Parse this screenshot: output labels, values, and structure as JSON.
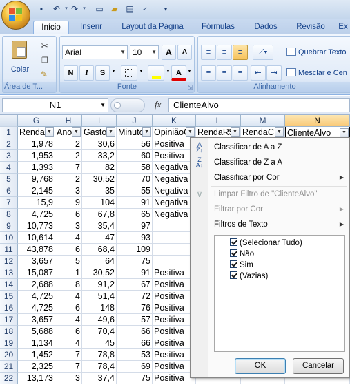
{
  "ribbon_tabs": [
    "Início",
    "Inserir",
    "Layout da Página",
    "Fórmulas",
    "Dados",
    "Revisão",
    "Ex"
  ],
  "clipboard": {
    "paste_label": "Colar",
    "group_label": "Área de T..."
  },
  "font": {
    "name": "Arial",
    "size": "10",
    "bold": "N",
    "italic": "I",
    "underline": "S",
    "group_label": "Fonte",
    "grow": "A",
    "shrink": "A"
  },
  "alignment": {
    "wrap_label": "Quebrar Texto",
    "merge_label": "Mesclar e Cen",
    "group_label": "Alinhamento"
  },
  "formula_bar": {
    "name_box": "N1",
    "fx": "fx",
    "content": "ClienteAlvo"
  },
  "columns": [
    "G",
    "H",
    "I",
    "J",
    "K",
    "L",
    "M",
    "N"
  ],
  "selected_column": "N",
  "row_numbers": [
    "1",
    "2",
    "3",
    "4",
    "5",
    "6",
    "7",
    "8",
    "9",
    "10",
    "11",
    "12",
    "13",
    "14",
    "15",
    "16",
    "17",
    "18",
    "19",
    "20",
    "21",
    "22"
  ],
  "headers": [
    "Renda",
    "Anos",
    "Gasto",
    "Minutos",
    "OpiniãoC",
    "RendaR$",
    "RendaC",
    "ClienteAlvo"
  ],
  "rows": [
    [
      "1,978",
      "2",
      "30,6",
      "56",
      "Positiva"
    ],
    [
      "1,953",
      "2",
      "33,2",
      "60",
      "Positiva"
    ],
    [
      "1,393",
      "7",
      "82",
      "58",
      "Negativa"
    ],
    [
      "9,768",
      "2",
      "30,52",
      "70",
      "Negativa"
    ],
    [
      "2,145",
      "3",
      "35",
      "55",
      "Negativa"
    ],
    [
      "15,9",
      "9",
      "104",
      "91",
      "Negativa"
    ],
    [
      "4,725",
      "6",
      "67,8",
      "65",
      "Negativa"
    ],
    [
      "10,773",
      "3",
      "35,4",
      "97",
      ""
    ],
    [
      "10,614",
      "4",
      "47",
      "93",
      ""
    ],
    [
      "43,878",
      "6",
      "68,4",
      "109",
      ""
    ],
    [
      "3,657",
      "5",
      "64",
      "75",
      ""
    ],
    [
      "15,087",
      "1",
      "30,52",
      "91",
      "Positiva"
    ],
    [
      "2,688",
      "8",
      "91,2",
      "67",
      "Positiva"
    ],
    [
      "4,725",
      "4",
      "51,4",
      "72",
      "Positiva"
    ],
    [
      "4,725",
      "6",
      "148",
      "76",
      "Positiva"
    ],
    [
      "3,657",
      "4",
      "49,6",
      "57",
      "Positiva"
    ],
    [
      "5,688",
      "6",
      "70,4",
      "66",
      "Positiva"
    ],
    [
      "1,134",
      "4",
      "45",
      "66",
      "Positiva"
    ],
    [
      "1,452",
      "7",
      "78,8",
      "53",
      "Positiva"
    ],
    [
      "2,325",
      "7",
      "78,4",
      "69",
      "Positiva"
    ],
    [
      "13,173",
      "3",
      "37,4",
      "75",
      "Positiva"
    ]
  ],
  "filter_menu": {
    "sort_az": "Classificar de A a Z",
    "sort_za": "Classificar de Z a A",
    "sort_color": "Classificar por Cor",
    "clear_filter": "Limpar Filtro de \"ClienteAlvo\"",
    "filter_color": "Filtrar por Cor",
    "text_filters": "Filtros de Texto",
    "items": [
      "(Selecionar Tudo)",
      "Não",
      "Sim",
      "(Vazias)"
    ],
    "ok": "OK",
    "cancel": "Cancelar"
  }
}
